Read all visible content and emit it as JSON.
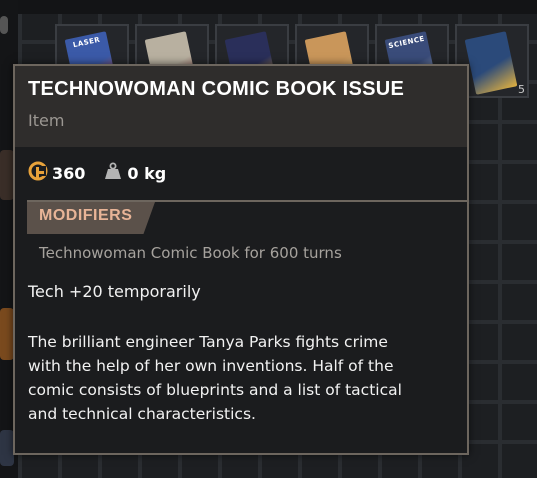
{
  "inventory": {
    "slots": [
      {
        "cover_title": "LASER",
        "cover_color": "#3b5aa8",
        "accent": "#d94a3a"
      },
      {
        "cover_title": "",
        "cover_color": "#b8b0a0",
        "accent": "#7a2e2e"
      },
      {
        "cover_title": "",
        "cover_color": "#2a2f5a",
        "accent": "#e3b03a"
      },
      {
        "cover_title": "",
        "cover_color": "#c9965a",
        "accent": "#e8c07a"
      },
      {
        "cover_title": "SCIENCE",
        "cover_color": "#3a4c7a",
        "accent": "#c5d0e0"
      },
      {
        "cover_title": "",
        "cover_color": "#2b4a7a",
        "accent": "#e0b040",
        "count": "5"
      }
    ]
  },
  "tooltip": {
    "title": "TECHNOWOMAN COMIC BOOK ISSUE",
    "type": "Item",
    "stats": {
      "value": "360",
      "value_icon": "currency-icon",
      "weight": "0 kg",
      "weight_icon": "weight-icon"
    },
    "modifiers_label": "MODIFIERS",
    "modifier": "Technowoman Comic Book for 600 turns",
    "effect": "Tech +20 temporarily",
    "description_lines": [
      "The brilliant engineer Tanya Parks fights crime",
      "with the help of her own inventions. Half of the",
      "comic consists of blueprints and a list of tactical",
      "and technical characteristics."
    ]
  },
  "colors": {
    "accent": "#e8b497",
    "currency": "#e8a23a",
    "border": "#6d665e"
  }
}
